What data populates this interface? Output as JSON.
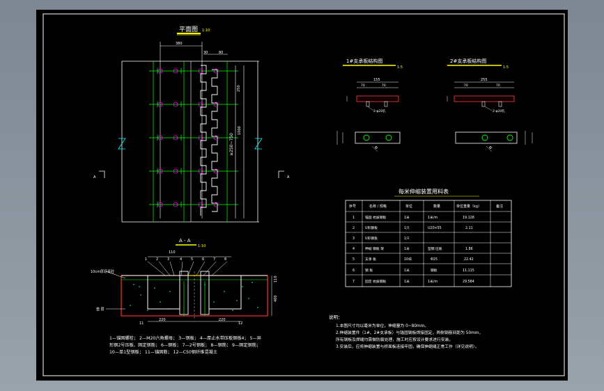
{
  "plan": {
    "title": "平面图",
    "scale": "1:10",
    "dims": {
      "top_left": "380",
      "top_right_a": "30",
      "top_right_b": "80",
      "right_v1": "250",
      "right_v2": "≥250~750",
      "right_v3": "1000"
    },
    "section_mark": "A"
  },
  "section": {
    "title": "A - A",
    "scale": "1:10",
    "dims": {
      "top": "110",
      "bottom_left": "220",
      "bottom_right": "220",
      "right_top": "110",
      "right_bot": "400"
    },
    "callouts": [
      "1",
      "2",
      "3",
      "4",
      "5",
      "6",
      "7",
      "8",
      "9",
      "10",
      "11",
      "12"
    ],
    "left_label": "10cm厚沥青砼",
    "left_label2": "垫 层"
  },
  "legend": {
    "line1": "1—锚固螺栓；  2—M20六角螺母；  3—钢板；  4—厚止水带压板钢板4；  5—异",
    "line2": "形钢2号压板、固定钢筋；  6—钢板；  7—2号钢板；  8—钢筋；  9—固定钢筋；",
    "line3": "10—单1型钢板；  11—锚固筋；  12—C50钢纤维混凝土"
  },
  "detail1": {
    "title": "1#支承板结构图",
    "scale": "1:5",
    "dim": "155",
    "sub1": "70",
    "sub2": "70",
    "note": "2-φ20孔",
    "tag": "Φ"
  },
  "detail2": {
    "title": "2#支承板结构图",
    "scale": "1:5",
    "dim": "255",
    "sub1": "70",
    "sub2": "70",
    "note": "2-φ20孔",
    "tag": "Φ"
  },
  "table": {
    "title": "每米伸缩装置用料表",
    "headers": [
      "序号",
      "名称 / 规格",
      "单位",
      "数量",
      "单位重量（kg）",
      "备注"
    ],
    "rows": [
      [
        "1",
        "锚固 抗拔钢板",
        "1米",
        "1米/m",
        "19.128",
        ""
      ],
      [
        "2",
        "U形钢板",
        "1只",
        "U20×55",
        "2.11",
        ""
      ],
      [
        "3",
        "U形钢板",
        "1只",
        "",
        "",
        ""
      ],
      [
        "4",
        "伸缩 钢板 架",
        "1米",
        "型钢 压板",
        "1.86",
        ""
      ],
      [
        "5",
        "支承 板",
        "10块",
        "Φ25",
        "22.42",
        ""
      ],
      [
        "6",
        "钢 板",
        "1米",
        "钢板",
        "11.115",
        ""
      ],
      [
        "7",
        "固定 抗拔钢板",
        "1米",
        "1米/m",
        "29.584",
        ""
      ]
    ]
  },
  "notes": {
    "title": "说明：",
    "lines": [
      "1.本图尺寸均以毫米为单位，伸缩量为 0~80mm。",
      "2.伸缩装置件（1#、2#支承板）与锚固钢板焊接固定，两侧钢筋间距为 50mm，",
      "  所有钢板及焊缝均需做防腐处理，施工时应按设计要求进行安装。",
      "3.安装后，应将伸缩装置与桥面板连接牢固，确保伸缩缝正常工作（详见说明）。"
    ]
  },
  "colors": {
    "bg": "#000000",
    "line_white": "#ffffff",
    "line_yellow": "#ffff00",
    "line_green": "#00ff00",
    "line_cyan": "#00ffff",
    "line_magenta": "#ff00ff",
    "line_red": "#ff3030",
    "outer_bg": "#8a929c"
  }
}
